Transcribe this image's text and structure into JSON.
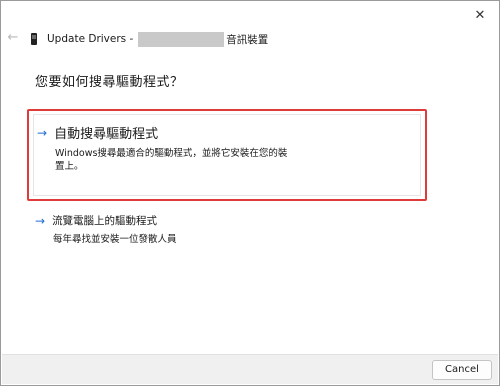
{
  "window": {
    "close_label": "✕",
    "back_label": "←",
    "title_prefix": "Update Drivers -",
    "title_suffix": "音訊裝置"
  },
  "heading": "您要如何搜尋驅動程式？",
  "options": [
    {
      "label": "自動搜尋驅動程式",
      "description": "Windows搜尋最適合的驅動程式，並將它安裝在您的裝置上。"
    },
    {
      "label": "流覽電腦上的驅動程式",
      "description": "每年尋找並安裝一位發散人員"
    }
  ],
  "footer": {
    "cancel_label": "Cancel"
  },
  "colors": {
    "highlight_border": "#e03b3b",
    "arrow": "#1f6fd0"
  },
  "icons": {
    "arrow": "→"
  }
}
